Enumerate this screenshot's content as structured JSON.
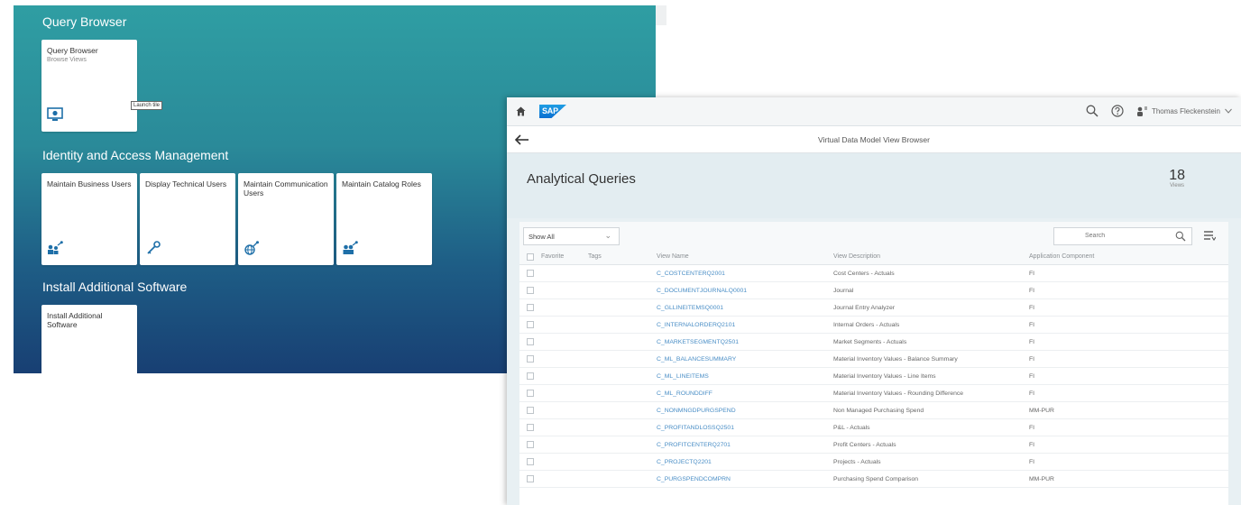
{
  "launchpad": {
    "groups": [
      {
        "title": "Query Browser"
      },
      {
        "title": "Identity and Access Management"
      },
      {
        "title": "Install Additional Software"
      }
    ],
    "tiles": [
      {
        "title": "Query Browser",
        "subtitle": "Browse Views",
        "icon": "monitor-icon"
      },
      {
        "title": "Maintain Business Users",
        "subtitle": "",
        "icon": "users-link-icon"
      },
      {
        "title": "Display Technical Users",
        "subtitle": "",
        "icon": "key-icon"
      },
      {
        "title": "Maintain Communication Users",
        "subtitle": "",
        "icon": "globe-link-icon"
      },
      {
        "title": "Maintain Catalog Roles",
        "subtitle": "",
        "icon": "user-group-icon"
      },
      {
        "title": "Install Additional Software",
        "subtitle": "",
        "icon": "blocks-icon"
      }
    ],
    "tooltip": "Launch tile"
  },
  "shell": {
    "logo": "SAP",
    "user_name": "Thomas Fleckenstein"
  },
  "page": {
    "title": "Virtual Data Model View Browser",
    "header_title": "Analytical Queries",
    "kpi_value": "18",
    "kpi_unit": "Views"
  },
  "toolbar": {
    "filter_value": "Show All",
    "search_placeholder": "Search"
  },
  "table": {
    "columns": [
      "Favorite",
      "Tags",
      "View Name",
      "View Description",
      "Application Component"
    ],
    "rows": [
      {
        "view_name": "C_COSTCENTERQ2001",
        "description": "Cost Centers - Actuals",
        "component": "FI"
      },
      {
        "view_name": "C_DOCUMENTJOURNALQ0001",
        "description": "Journal",
        "component": "FI"
      },
      {
        "view_name": "C_GLLINEITEMSQ0001",
        "description": "Journal Entry Analyzer",
        "component": "FI"
      },
      {
        "view_name": "C_INTERNALORDERQ2101",
        "description": "Internal Orders - Actuals",
        "component": "FI"
      },
      {
        "view_name": "C_MARKETSEGMENTQ2501",
        "description": "Market Segments - Actuals",
        "component": "FI"
      },
      {
        "view_name": "C_ML_BALANCESUMMARY",
        "description": "Material Inventory Values - Balance Summary",
        "component": "FI"
      },
      {
        "view_name": "C_ML_LINEITEMS",
        "description": "Material Inventory Values - Line Items",
        "component": "FI"
      },
      {
        "view_name": "C_ML_ROUNDDIFF",
        "description": "Material Inventory Values - Rounding Difference",
        "component": "FI"
      },
      {
        "view_name": "C_NONMNGDPURGSPEND",
        "description": "Non Managed Purchasing Spend",
        "component": "MM-PUR"
      },
      {
        "view_name": "C_PROFITANDLOSSQ2501",
        "description": "P&L - Actuals",
        "component": "FI"
      },
      {
        "view_name": "C_PROFITCENTERQ2701",
        "description": "Profit Centers - Actuals",
        "component": "FI"
      },
      {
        "view_name": "C_PROJECTQ2201",
        "description": "Projects - Actuals",
        "component": "FI"
      },
      {
        "view_name": "C_PURGSPENDCOMPRN",
        "description": "Purchasing Spend Comparison",
        "component": "MM-PUR"
      }
    ]
  }
}
